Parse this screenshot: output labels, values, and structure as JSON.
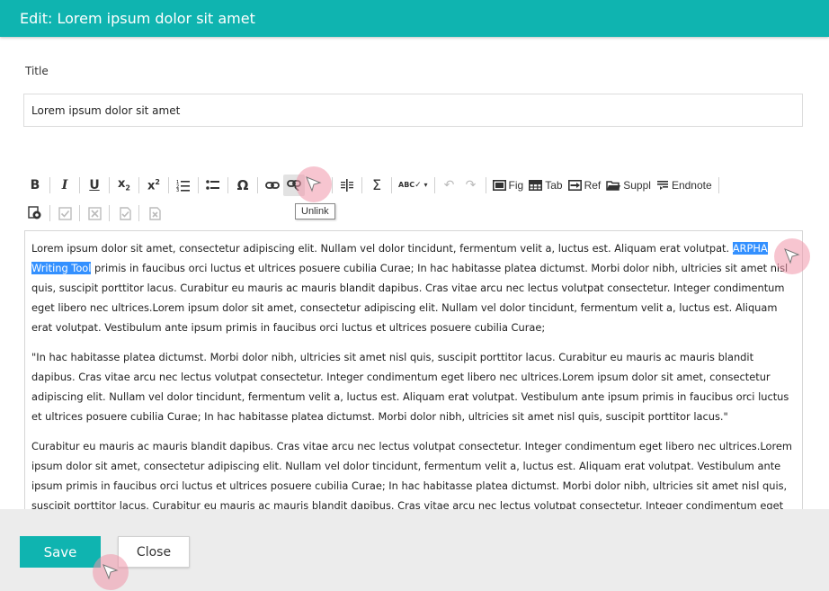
{
  "header": {
    "title": "Edit: Lorem ipsum dolor sit amet"
  },
  "form": {
    "title_label": "Title",
    "title_value": "Lorem ipsum dolor sit amet"
  },
  "toolbar": {
    "fig_label": "Fig",
    "tab_label": "Tab",
    "ref_label": "Ref",
    "suppl_label": "Suppl",
    "endnote_label": "Endnote",
    "tooltip": "Unlink"
  },
  "editor": {
    "p1_before": "Lorem ipsum dolor sit amet, consectetur adipiscing elit. Nullam vel dolor tincidunt, fermentum velit a, luctus est. Aliquam erat volutpat. ",
    "p1_selected": "ARPHA Writing Tool",
    "p1_after": " primis in faucibus orci luctus et ultrices posuere cubilia Curae; In hac habitasse platea dictumst. Morbi dolor nibh, ultricies sit amet nisl quis, suscipit porttitor lacus. Curabitur eu mauris ac mauris blandit dapibus. Cras vitae arcu nec lectus volutpat consectetur. Integer condimentum eget libero nec ultrices.Lorem ipsum dolor sit amet, consectetur adipiscing elit. Nullam vel dolor tincidunt, fermentum velit a, luctus est. Aliquam erat volutpat. Vestibulum ante ipsum primis in faucibus orci luctus et ultrices posuere cubilia Curae;",
    "p2": "\"In hac habitasse platea dictumst. Morbi dolor nibh, ultricies sit amet nisl quis, suscipit porttitor lacus. Curabitur eu mauris ac mauris blandit dapibus. Cras vitae arcu nec lectus volutpat consectetur. Integer condimentum eget libero nec ultrices.Lorem ipsum dolor sit amet, consectetur adipiscing elit. Nullam vel dolor tincidunt, fermentum velit a, luctus est. Aliquam erat volutpat. Vestibulum ante ipsum primis in faucibus orci luctus et ultrices posuere cubilia Curae; In hac habitasse platea dictumst. Morbi dolor nibh, ultricies sit amet nisl quis, suscipit porttitor lacus.\"",
    "p3": "Curabitur eu mauris ac mauris blandit dapibus. Cras vitae arcu nec lectus volutpat consectetur. Integer condimentum eget libero nec ultrices.Lorem ipsum dolor sit amet, consectetur adipiscing elit. Nullam vel dolor tincidunt, fermentum velit a, luctus est. Aliquam erat volutpat. Vestibulum ante ipsum primis in faucibus orci luctus et ultrices posuere cubilia Curae; In hac habitasse platea dictumst. Morbi dolor nibh, ultricies sit amet nisl quis, suscipit porttitor lacus. Curabitur eu mauris ac mauris blandit dapibus. Cras vitae arcu nec lectus volutpat consectetur. Integer condimentum eget libero nec ultrices."
  },
  "footer": {
    "save_label": "Save",
    "close_label": "Close"
  },
  "colors": {
    "accent": "#0fb4b0",
    "selection": "#3390ff",
    "footer_bg": "#ececec"
  }
}
